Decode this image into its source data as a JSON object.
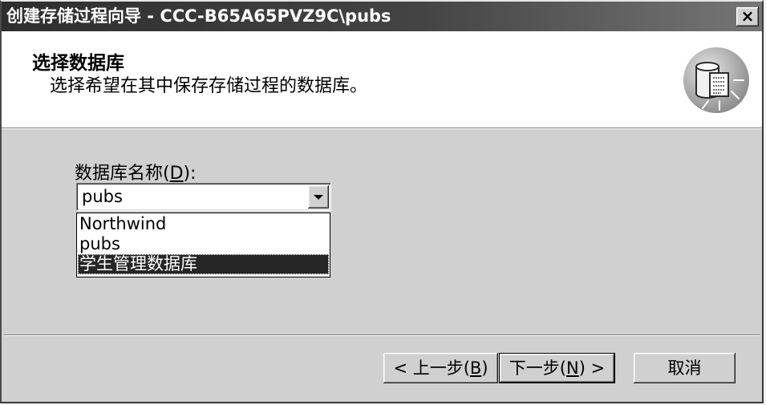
{
  "window": {
    "title": "创建存储过程向导 - CCC-B65A65PVZ9C\\pubs",
    "close_symbol": "×",
    "close_icon": "close-icon"
  },
  "header": {
    "title": "选择数据库",
    "subtitle": "选择希望在其中保存存储过程的数据库。",
    "icon": "database-wizard-icon"
  },
  "database_field": {
    "label": {
      "prefix": "数据库名称(",
      "access_key": "D",
      "suffix": "):"
    },
    "value": "pubs",
    "dropdown_icon": "dropdown-arrow-icon",
    "options": [
      "Northwind",
      "pubs",
      "学生管理数据库"
    ],
    "highlighted_index": 2
  },
  "buttons": {
    "back": {
      "prefix": "< 上一步(",
      "access_key": "B",
      "suffix": ")"
    },
    "next": {
      "prefix": "下一步(",
      "access_key": "N",
      "suffix": ") >"
    },
    "cancel": {
      "label": "取消"
    }
  },
  "colors": {
    "title_bar_start": "#2e2e2e",
    "title_bar_end": "#767676",
    "face": "#d0d0d0",
    "highlight": "#262626",
    "highlight_text": "#ffffff",
    "header_background": "#ffffff"
  }
}
